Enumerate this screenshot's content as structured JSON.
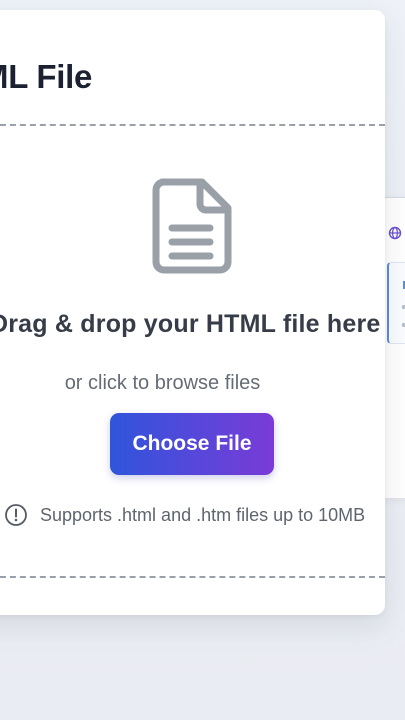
{
  "card": {
    "title": "ML File"
  },
  "dropzone": {
    "title": "Drag & drop your HTML file here",
    "subtitle": "or click to browse files",
    "button_label": "Choose File",
    "support_text": "Supports .html and .htm files up to 10MB"
  },
  "icons": {
    "document": "document-icon",
    "info": "info-circle-icon",
    "globe": "globe-icon"
  },
  "colors": {
    "button_gradient_start": "#2f55db",
    "button_gradient_end": "#7a3bd8",
    "icon_gray": "#9aa0a8"
  }
}
